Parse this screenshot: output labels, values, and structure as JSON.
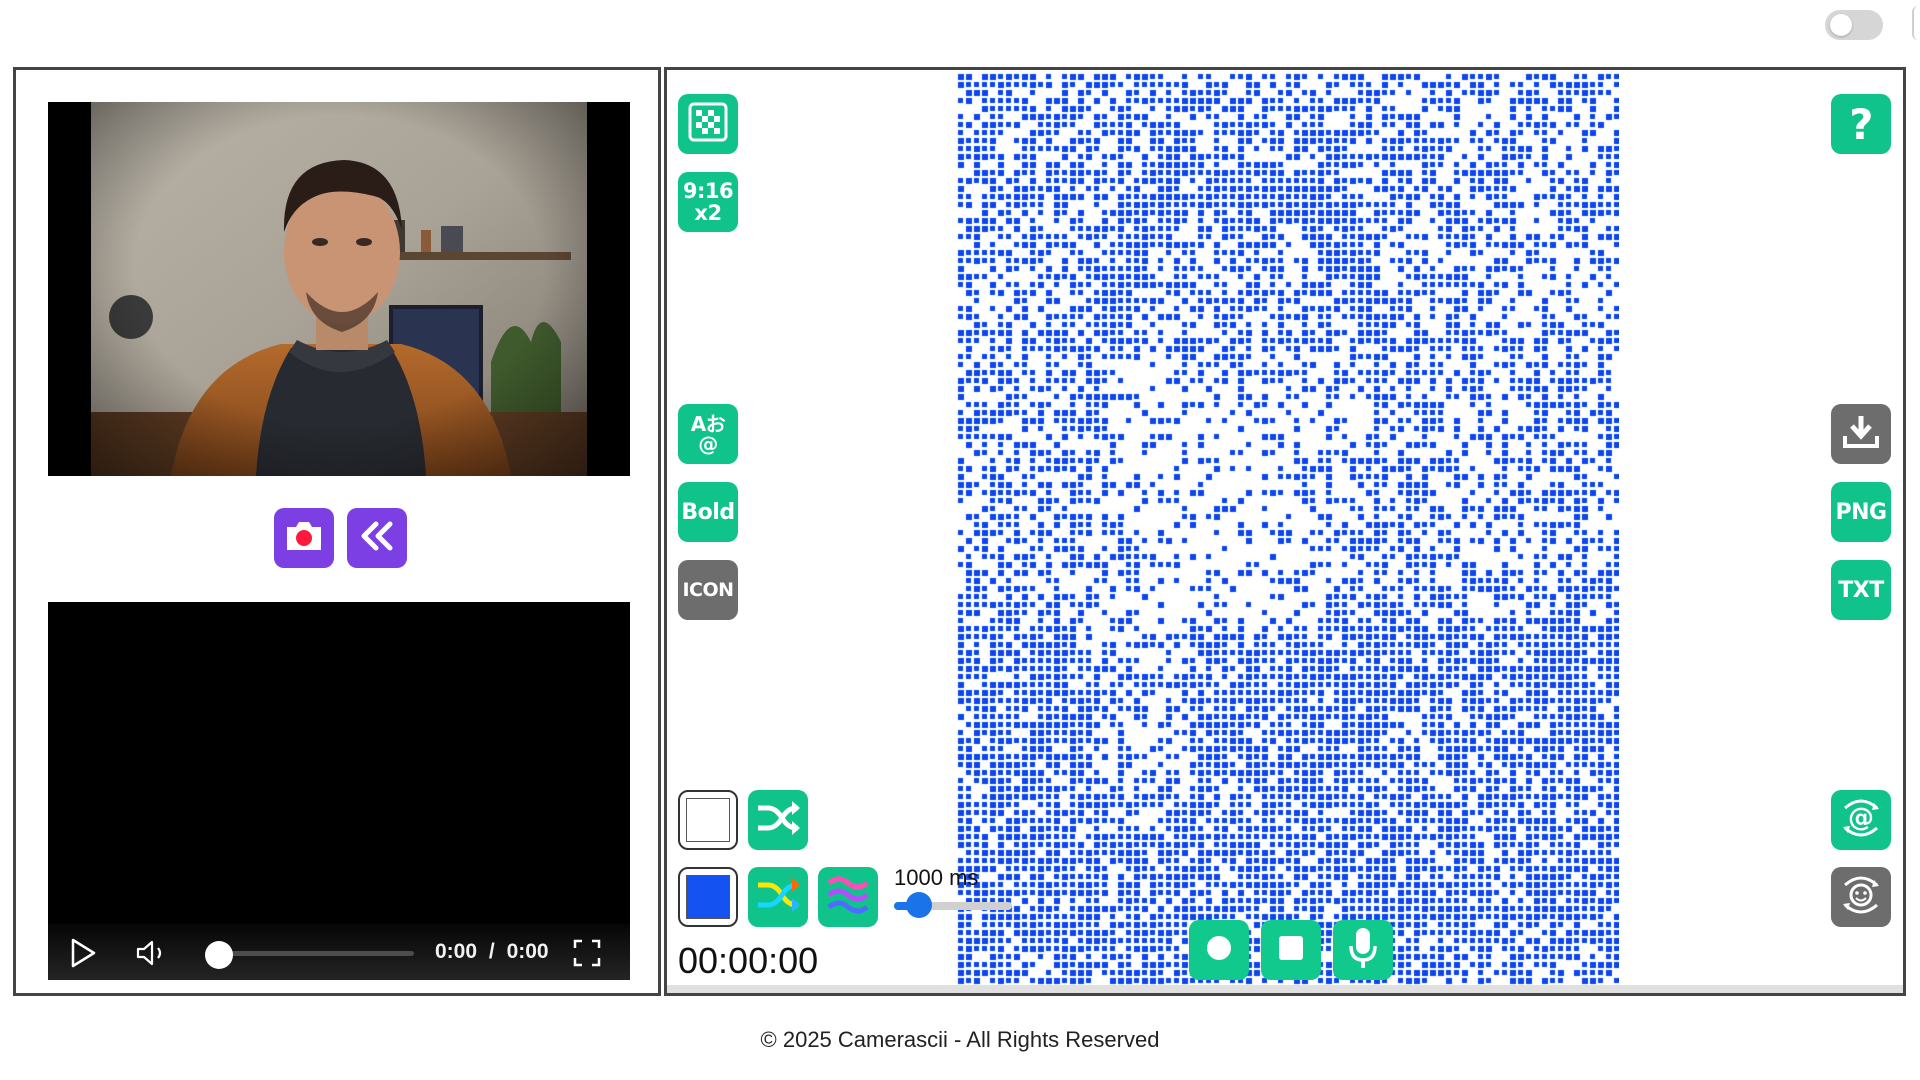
{
  "theme": {
    "accent_green": "#10c38a",
    "accent_purple": "#7b3fe4",
    "ascii_blue": "#0b45f0",
    "swatch_color": "#1552f2",
    "disabled_grey": "#6d6d6d"
  },
  "header": {
    "dark_mode_toggle": "off"
  },
  "left_panel": {
    "camera_controls": {
      "capture_icon": "camera-icon",
      "back_icon": "double-chevron-left-icon"
    },
    "video_player": {
      "time_current": "0:00",
      "time_separator": "/",
      "time_total": "0:00",
      "progress": 0
    }
  },
  "right_panel": {
    "left_tools": [
      {
        "name": "charset-random-button",
        "icon": "glitch-pattern-icon",
        "color": "green"
      },
      {
        "name": "aspect-ratio-button",
        "label_top": "9:16",
        "label_bottom": "x2",
        "color": "green"
      },
      {
        "name": "character-set-button",
        "label_top": "Aお",
        "label_bottom": "@",
        "color": "green"
      },
      {
        "name": "bold-button",
        "label": "Bold",
        "color": "green"
      },
      {
        "name": "icon-mode-button",
        "label": "ICON",
        "color": "grey"
      }
    ],
    "right_tools": [
      {
        "name": "help-button",
        "label": "?",
        "color": "green"
      },
      {
        "name": "download-button",
        "icon": "download-icon",
        "color": "grey"
      },
      {
        "name": "png-export-button",
        "label": "PNG",
        "color": "green"
      },
      {
        "name": "txt-export-button",
        "label": "TXT",
        "color": "green"
      },
      {
        "name": "ascii-face-button",
        "icon": "at-cycle-icon",
        "color": "green"
      },
      {
        "name": "emoji-face-button",
        "icon": "smiley-cycle-icon",
        "color": "grey"
      }
    ],
    "background_color": "#ffffff",
    "foreground_color": "#1552f2",
    "speed_value": "1000",
    "speed_unit": "ms",
    "speed_fraction": 0.22,
    "timer": "00:00:00",
    "recording_controls": [
      "record-icon",
      "stop-icon",
      "microphone-icon"
    ]
  },
  "footer": {
    "copyright": "© 2025 Camerascii - All Rights Reserved"
  }
}
